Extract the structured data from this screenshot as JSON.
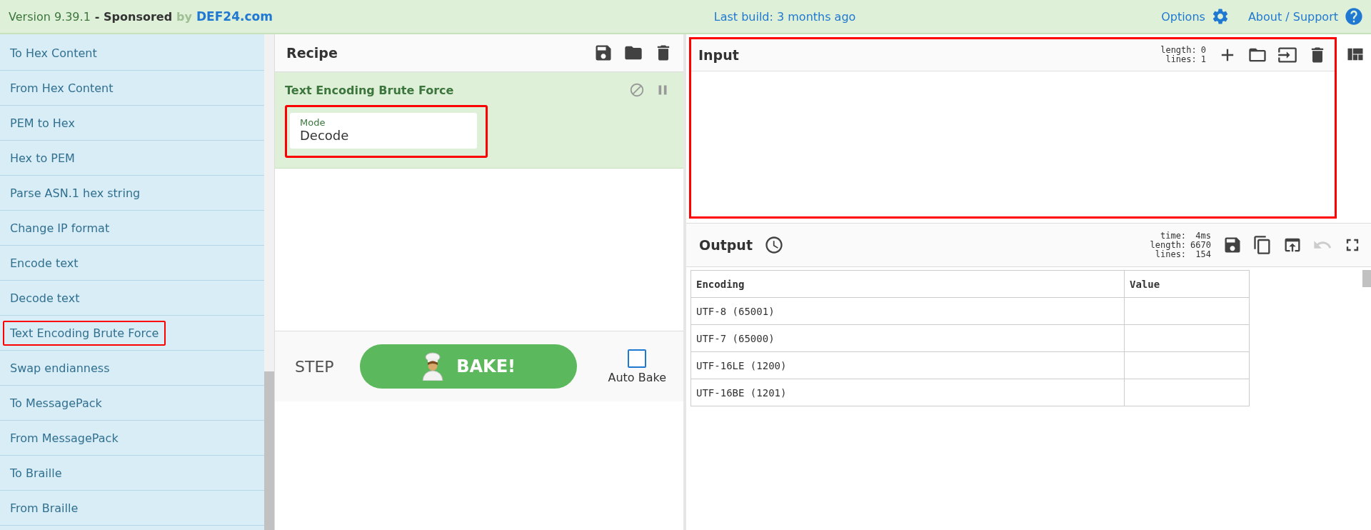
{
  "top_bar": {
    "version": "Version 9.39.1",
    "sponsor": "- Sponsored",
    "sponsor_by": "by",
    "sponsor_link": "DEF24.com",
    "last_build": "Last build: 3 months ago",
    "options": "Options",
    "about": "About / Support"
  },
  "operations": [
    {
      "label": "To Hex Content",
      "highlighted": false
    },
    {
      "label": "From Hex Content",
      "highlighted": false
    },
    {
      "label": "PEM to Hex",
      "highlighted": false
    },
    {
      "label": "Hex to PEM",
      "highlighted": false
    },
    {
      "label": "Parse ASN.1 hex string",
      "highlighted": false
    },
    {
      "label": "Change IP format",
      "highlighted": false
    },
    {
      "label": "Encode text",
      "highlighted": false
    },
    {
      "label": "Decode text",
      "highlighted": false
    },
    {
      "label": "Text Encoding Brute Force",
      "highlighted": true
    },
    {
      "label": "Swap endianness",
      "highlighted": false
    },
    {
      "label": "To MessagePack",
      "highlighted": false
    },
    {
      "label": "From MessagePack",
      "highlighted": false
    },
    {
      "label": "To Braille",
      "highlighted": false
    },
    {
      "label": "From Braille",
      "highlighted": false
    }
  ],
  "recipe": {
    "title": "Recipe",
    "operation": {
      "name": "Text Encoding Brute Force",
      "disabled": false,
      "breakpoint": false,
      "arg": {
        "label": "Mode",
        "value": "Decode",
        "highlighted": true
      }
    },
    "step": "STEP",
    "bake": "BAKE!",
    "auto_bake": {
      "label": "Auto Bake",
      "checked": false
    }
  },
  "input": {
    "title": "Input",
    "highlighted": true,
    "stats": [
      {
        "key": "length:",
        "value": "0"
      },
      {
        "key": "lines:",
        "value": "1"
      }
    ]
  },
  "output": {
    "title": "Output",
    "stats": [
      {
        "key": "time:",
        "value": "4ms"
      },
      {
        "key": "length:",
        "value": "6670"
      },
      {
        "key": "lines:",
        "value": "154"
      }
    ],
    "table": {
      "columns": [
        "Encoding",
        "Value"
      ],
      "rows": [
        [
          "UTF-8 (65001)",
          ""
        ],
        [
          "UTF-7 (65000)",
          ""
        ],
        [
          "UTF-16LE (1200)",
          ""
        ],
        [
          "UTF-16BE (1201)",
          ""
        ]
      ]
    }
  }
}
